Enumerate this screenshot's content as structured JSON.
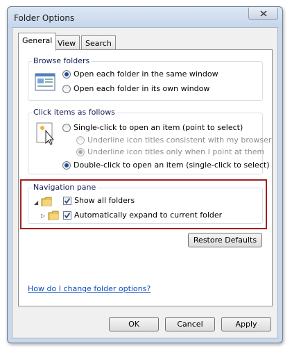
{
  "window": {
    "title": "Folder Options"
  },
  "tabs": [
    {
      "label": "General"
    },
    {
      "label": "View"
    },
    {
      "label": "Search"
    }
  ],
  "browse_folders": {
    "heading": "Browse folders",
    "options": [
      {
        "label": "Open each folder in the same window",
        "selected": true
      },
      {
        "label": "Open each folder in its own window",
        "selected": false
      }
    ]
  },
  "click_items": {
    "heading": "Click items as follows",
    "options": [
      {
        "label": "Single-click to open an item (point to select)",
        "selected": false
      },
      {
        "label": "Underline icon titles consistent with my browser",
        "selected": false,
        "enabled": false
      },
      {
        "label": "Underline icon titles only when I point at them",
        "selected": true,
        "enabled": false
      },
      {
        "label": "Double-click to open an item (single-click to select)",
        "selected": true
      }
    ]
  },
  "navigation_pane": {
    "heading": "Navigation pane",
    "options": [
      {
        "label": "Show all folders",
        "checked": true
      },
      {
        "label": "Automatically expand to current folder",
        "checked": true
      }
    ]
  },
  "restore_defaults_label": "Restore Defaults",
  "help_link": "How do I change folder options?",
  "footer": {
    "ok_label": "OK",
    "cancel_label": "Cancel",
    "apply_label": "Apply"
  },
  "colors": {
    "accent": "#1d4e94",
    "link": "#0b4ec1",
    "highlight_border": "#a32020",
    "group_heading": "#151c55"
  }
}
